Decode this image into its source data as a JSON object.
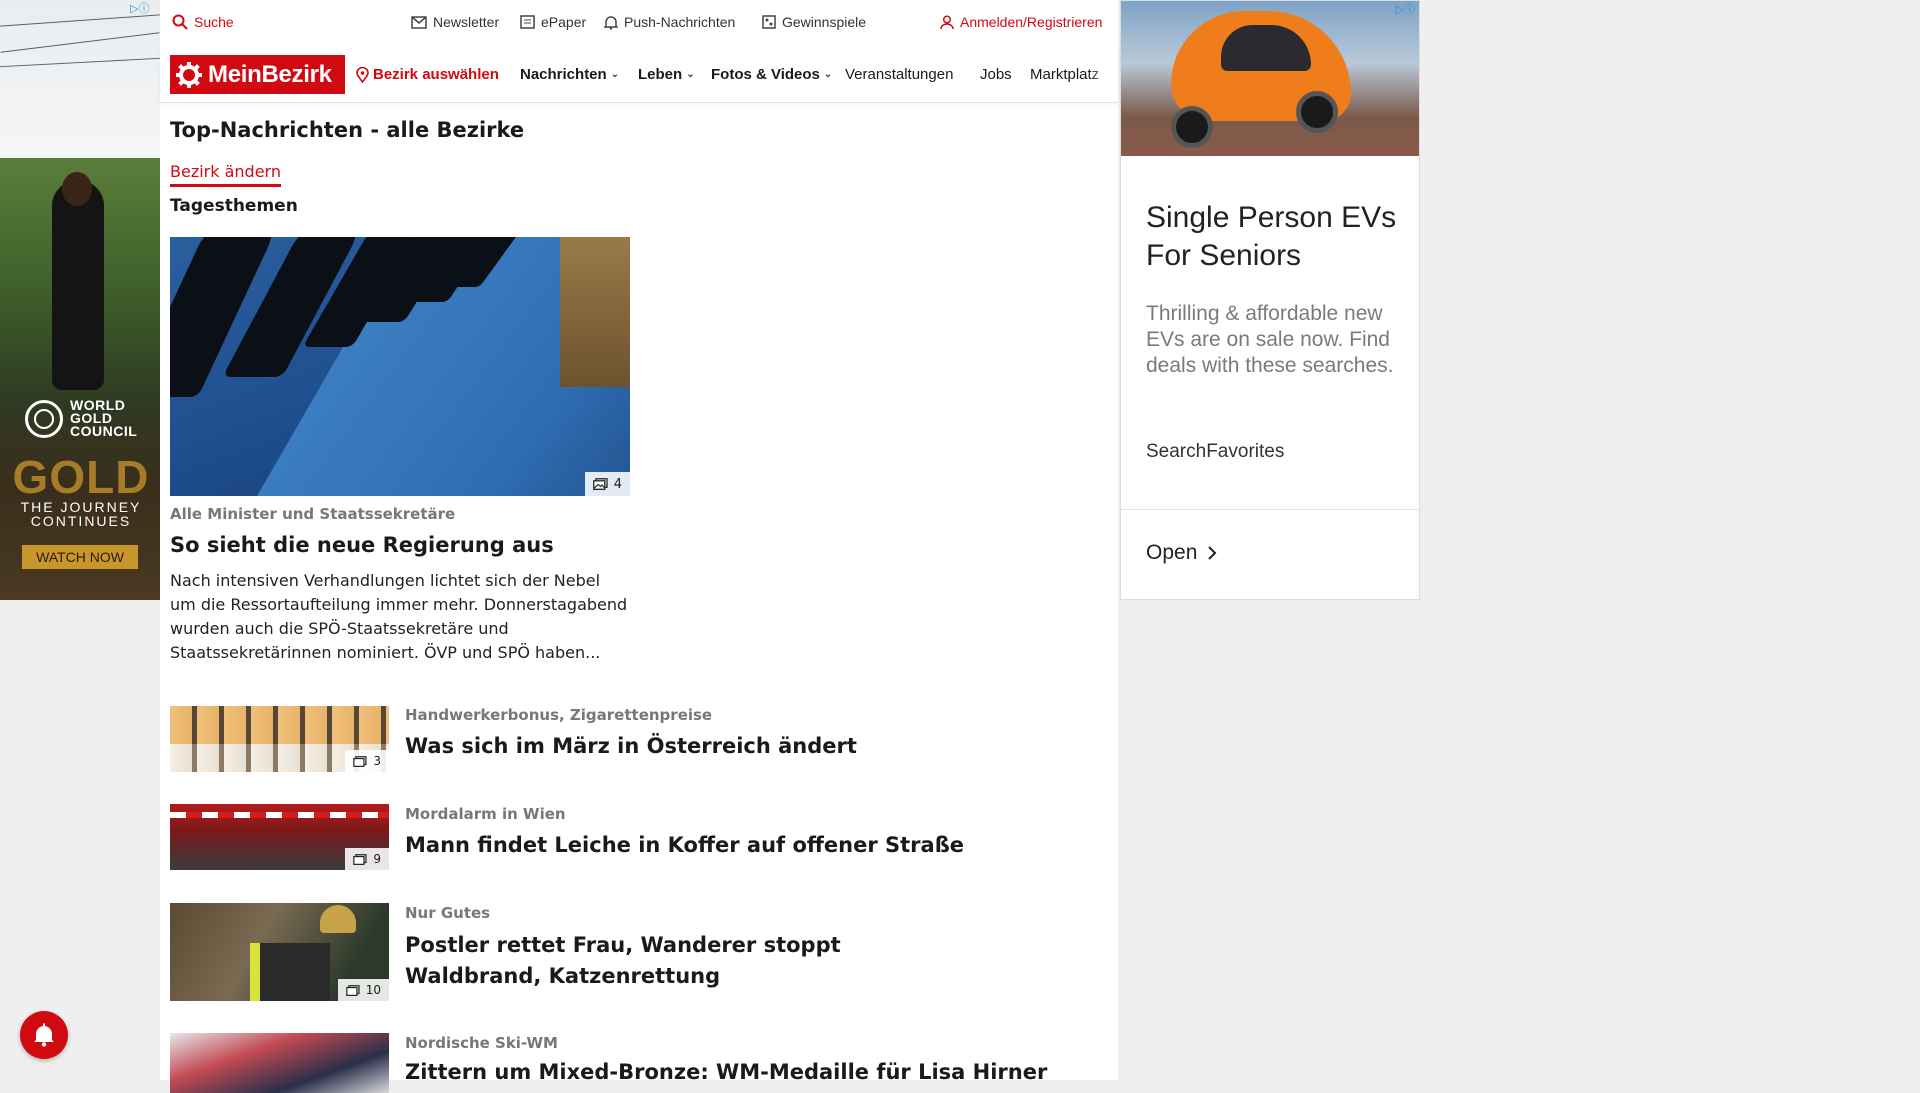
{
  "left_ad": {
    "brand": "WORLD GOLD COUNCIL",
    "headline": "GOLD",
    "tagline": "THE JOURNEY CONTINUES",
    "cta": "WATCH NOW"
  },
  "topbar": {
    "search": "Suche",
    "newsletter": "Newsletter",
    "epaper": "ePaper",
    "push": "Push-Nachrichten",
    "contests": "Gewinnspiele",
    "login": "Anmelden/Registrieren"
  },
  "nav": {
    "brand": "MeinBezirk",
    "district": "Bezirk auswählen",
    "items": [
      "Nachrichten",
      "Leben",
      "Fotos & Videos",
      "Veranstaltungen",
      "Jobs",
      "Marktplatz"
    ]
  },
  "page": {
    "title": "Top-Nachrichten - alle Bezirke",
    "change_district": "Bezirk ändern",
    "section": "Tagesthemen"
  },
  "hero": {
    "image_count": "4",
    "kicker": "Alle Minister und Staatssekretäre",
    "title": "So sieht die neue Regierung aus",
    "teaser": "Nach intensiven Verhandlungen lichtet sich der Nebel um die Ressortaufteilung immer mehr. Donnerstagabend wurden auch die SPÖ-Staatssekretäre und Staatssekretärinnen nominiert. ÖVP und SPÖ haben..."
  },
  "articles": [
    {
      "kicker": "Handwerkerbonus, Zigarettenpreise",
      "title": "Was sich im März in Österreich ändert",
      "image_count": "3"
    },
    {
      "kicker": "Mordalarm in Wien",
      "title": "Mann findet Leiche in Koffer auf offener Straße",
      "image_count": "9"
    },
    {
      "kicker": "Nur Gutes",
      "title": "Postler rettet Frau, Wanderer stoppt Waldbrand, Katzenrettung",
      "image_count": "10"
    },
    {
      "kicker": "Nordische Ski-WM",
      "title": "Zittern um Mixed-Bronze: WM-Medaille für Lisa Hirner"
    }
  ],
  "right_ad": {
    "title": "Single Person EVs For Seniors",
    "body": "Thrilling & affordable new EVs are on sale now. Find deals with these searches.",
    "source": "SearchFavorites",
    "cta": "Open"
  },
  "colors": {
    "brand_red": "#d10a11"
  }
}
